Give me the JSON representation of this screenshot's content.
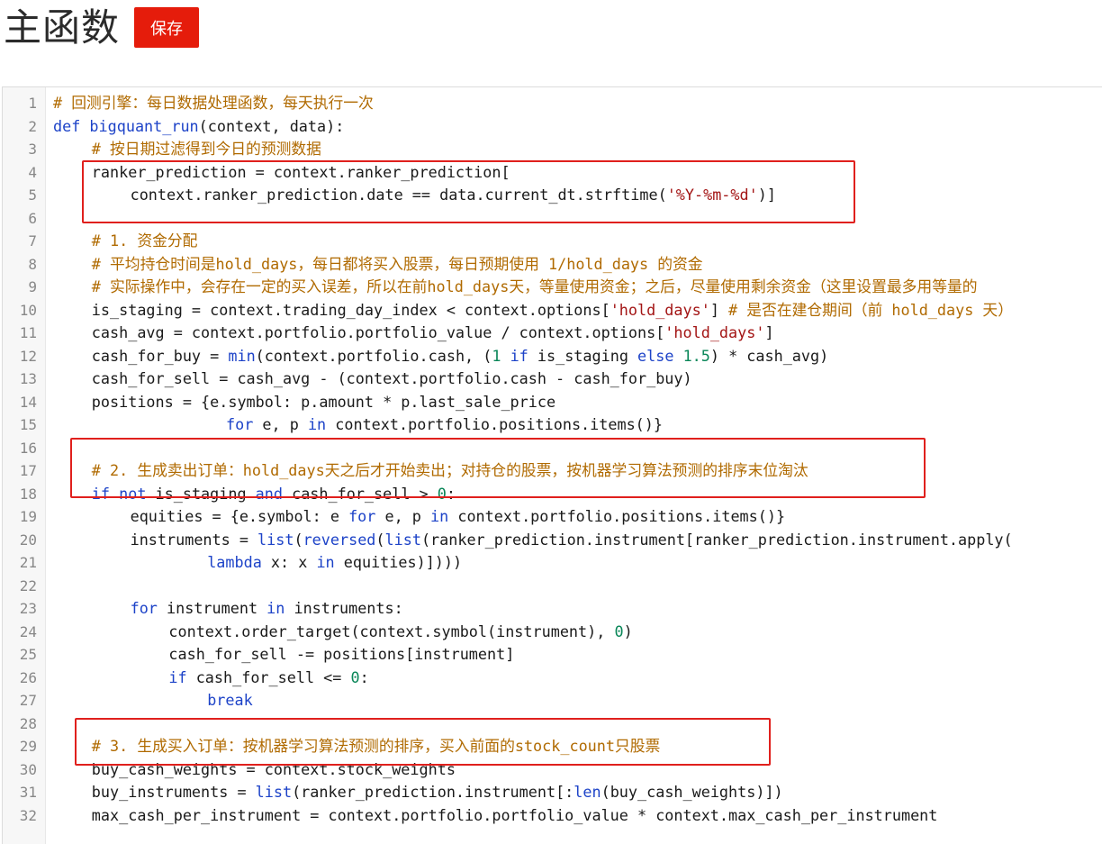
{
  "page": {
    "title": "主函数",
    "save_label": "保存"
  },
  "editor": {
    "lines": [
      {
        "n": "1",
        "indent": 0,
        "tokens": [
          {
            "t": "# 回测引擎：每日数据处理函数，每天执行一次",
            "c": "c"
          }
        ]
      },
      {
        "n": "2",
        "indent": 0,
        "tokens": [
          {
            "t": "def ",
            "c": "k"
          },
          {
            "t": "bigquant_run",
            "c": "fn"
          },
          {
            "t": "(context, data):",
            "c": "p"
          }
        ]
      },
      {
        "n": "3",
        "indent": 4,
        "tokens": [
          {
            "t": "# 按日期过滤得到今日的预测数据",
            "c": "c"
          }
        ]
      },
      {
        "n": "4",
        "indent": 4,
        "tokens": [
          {
            "t": "ranker_prediction = context.ranker_prediction[",
            "c": "p"
          }
        ]
      },
      {
        "n": "5",
        "indent": 8,
        "tokens": [
          {
            "t": "context.ranker_prediction.date == data.current_dt.strftime(",
            "c": "p"
          },
          {
            "t": "'%Y-%m-%d'",
            "c": "s"
          },
          {
            "t": ")]",
            "c": "p"
          }
        ]
      },
      {
        "n": "6",
        "indent": 0,
        "tokens": []
      },
      {
        "n": "7",
        "indent": 4,
        "tokens": [
          {
            "t": "# 1. 资金分配",
            "c": "c"
          }
        ]
      },
      {
        "n": "8",
        "indent": 4,
        "tokens": [
          {
            "t": "# 平均持仓时间是hold_days，每日都将买入股票，每日预期使用 1/hold_days 的资金",
            "c": "c"
          }
        ]
      },
      {
        "n": "9",
        "indent": 4,
        "tokens": [
          {
            "t": "# 实际操作中，会存在一定的买入误差，所以在前hold_days天，等量使用资金；之后，尽量使用剩余资金（这里设置最多用等量的",
            "c": "c"
          }
        ]
      },
      {
        "n": "10",
        "indent": 4,
        "tokens": [
          {
            "t": "is_staging = context.trading_day_index < context.options[",
            "c": "p"
          },
          {
            "t": "'hold_days'",
            "c": "s"
          },
          {
            "t": "] ",
            "c": "p"
          },
          {
            "t": "# 是否在建仓期间（前 hold_days 天）",
            "c": "c"
          }
        ]
      },
      {
        "n": "11",
        "indent": 4,
        "tokens": [
          {
            "t": "cash_avg = context.portfolio.portfolio_value / context.options[",
            "c": "p"
          },
          {
            "t": "'hold_days'",
            "c": "s"
          },
          {
            "t": "]",
            "c": "p"
          }
        ]
      },
      {
        "n": "12",
        "indent": 4,
        "tokens": [
          {
            "t": "cash_for_buy = ",
            "c": "p"
          },
          {
            "t": "min",
            "c": "b"
          },
          {
            "t": "(context.portfolio.cash, (",
            "c": "p"
          },
          {
            "t": "1",
            "c": "n"
          },
          {
            "t": " if ",
            "c": "k"
          },
          {
            "t": "is_staging ",
            "c": "p"
          },
          {
            "t": "else ",
            "c": "k"
          },
          {
            "t": "1.5",
            "c": "n"
          },
          {
            "t": ") * cash_avg)",
            "c": "p"
          }
        ]
      },
      {
        "n": "13",
        "indent": 4,
        "tokens": [
          {
            "t": "cash_for_sell = cash_avg - (context.portfolio.cash - cash_for_buy)",
            "c": "p"
          }
        ]
      },
      {
        "n": "14",
        "indent": 4,
        "tokens": [
          {
            "t": "positions = {e.symbol: p.amount * p.last_sale_price",
            "c": "p"
          }
        ]
      },
      {
        "n": "15",
        "indent": 17,
        "tokens": [
          {
            "t": " for ",
            "c": "k"
          },
          {
            "t": "e, p ",
            "c": "p"
          },
          {
            "t": "in ",
            "c": "k"
          },
          {
            "t": "context.portfolio.positions.items()}",
            "c": "p"
          }
        ]
      },
      {
        "n": "16",
        "indent": 0,
        "tokens": []
      },
      {
        "n": "17",
        "indent": 4,
        "tokens": [
          {
            "t": "# 2. 生成卖出订单：hold_days天之后才开始卖出；对持仓的股票，按机器学习算法预测的排序末位淘汰",
            "c": "c"
          }
        ]
      },
      {
        "n": "18",
        "indent": 4,
        "tokens": [
          {
            "t": "if not ",
            "c": "k"
          },
          {
            "t": "is_staging ",
            "c": "p"
          },
          {
            "t": "and ",
            "c": "k"
          },
          {
            "t": "cash_for_sell > ",
            "c": "p"
          },
          {
            "t": "0",
            "c": "n"
          },
          {
            "t": ":",
            "c": "p"
          }
        ]
      },
      {
        "n": "19",
        "indent": 8,
        "tokens": [
          {
            "t": "equities = {e.symbol: e ",
            "c": "p"
          },
          {
            "t": "for ",
            "c": "k"
          },
          {
            "t": "e, p ",
            "c": "p"
          },
          {
            "t": "in ",
            "c": "k"
          },
          {
            "t": "context.portfolio.positions.items()}",
            "c": "p"
          }
        ]
      },
      {
        "n": "20",
        "indent": 8,
        "tokens": [
          {
            "t": "instruments = ",
            "c": "p"
          },
          {
            "t": "list",
            "c": "b"
          },
          {
            "t": "(",
            "c": "p"
          },
          {
            "t": "reversed",
            "c": "b"
          },
          {
            "t": "(",
            "c": "p"
          },
          {
            "t": "list",
            "c": "b"
          },
          {
            "t": "(ranker_prediction.instrument[ranker_prediction.instrument.apply(",
            "c": "p"
          }
        ]
      },
      {
        "n": "21",
        "indent": 16,
        "tokens": [
          {
            "t": "lambda ",
            "c": "k"
          },
          {
            "t": "x: x ",
            "c": "p"
          },
          {
            "t": "in ",
            "c": "k"
          },
          {
            "t": "equities)])))",
            "c": "p"
          }
        ]
      },
      {
        "n": "22",
        "indent": 0,
        "tokens": []
      },
      {
        "n": "23",
        "indent": 8,
        "tokens": [
          {
            "t": "for ",
            "c": "k"
          },
          {
            "t": "instrument ",
            "c": "p"
          },
          {
            "t": "in ",
            "c": "k"
          },
          {
            "t": "instruments:",
            "c": "p"
          }
        ]
      },
      {
        "n": "24",
        "indent": 12,
        "tokens": [
          {
            "t": "context.order_target(context.symbol(instrument), ",
            "c": "p"
          },
          {
            "t": "0",
            "c": "n"
          },
          {
            "t": ")",
            "c": "p"
          }
        ]
      },
      {
        "n": "25",
        "indent": 12,
        "tokens": [
          {
            "t": "cash_for_sell -= positions[instrument]",
            "c": "p"
          }
        ]
      },
      {
        "n": "26",
        "indent": 12,
        "tokens": [
          {
            "t": "if ",
            "c": "k"
          },
          {
            "t": "cash_for_sell <= ",
            "c": "p"
          },
          {
            "t": "0",
            "c": "n"
          },
          {
            "t": ":",
            "c": "p"
          }
        ]
      },
      {
        "n": "27",
        "indent": 16,
        "tokens": [
          {
            "t": "break",
            "c": "k"
          }
        ]
      },
      {
        "n": "28",
        "indent": 0,
        "tokens": []
      },
      {
        "n": "29",
        "indent": 4,
        "tokens": [
          {
            "t": "# 3. 生成买入订单：按机器学习算法预测的排序，买入前面的stock_count只股票",
            "c": "c"
          }
        ]
      },
      {
        "n": "30",
        "indent": 4,
        "tokens": [
          {
            "t": "buy_cash_weights = context.stock_weights",
            "c": "p"
          }
        ]
      },
      {
        "n": "31",
        "indent": 4,
        "tokens": [
          {
            "t": "buy_instruments = ",
            "c": "p"
          },
          {
            "t": "list",
            "c": "b"
          },
          {
            "t": "(ranker_prediction.instrument[:",
            "c": "p"
          },
          {
            "t": "len",
            "c": "b"
          },
          {
            "t": "(buy_cash_weights)])",
            "c": "p"
          }
        ]
      },
      {
        "n": "32",
        "indent": 4,
        "tokens": [
          {
            "t": "max_cash_per_instrument = context.portfolio.portfolio_value * context.max_cash_per_instrument",
            "c": "p"
          }
        ]
      }
    ]
  },
  "colors": {
    "save_button": "#e51c0b",
    "highlight_box": "#e0201d",
    "keyword": "#1d43c8",
    "comment": "#b06a00",
    "string": "#a31515",
    "number": "#098658"
  }
}
